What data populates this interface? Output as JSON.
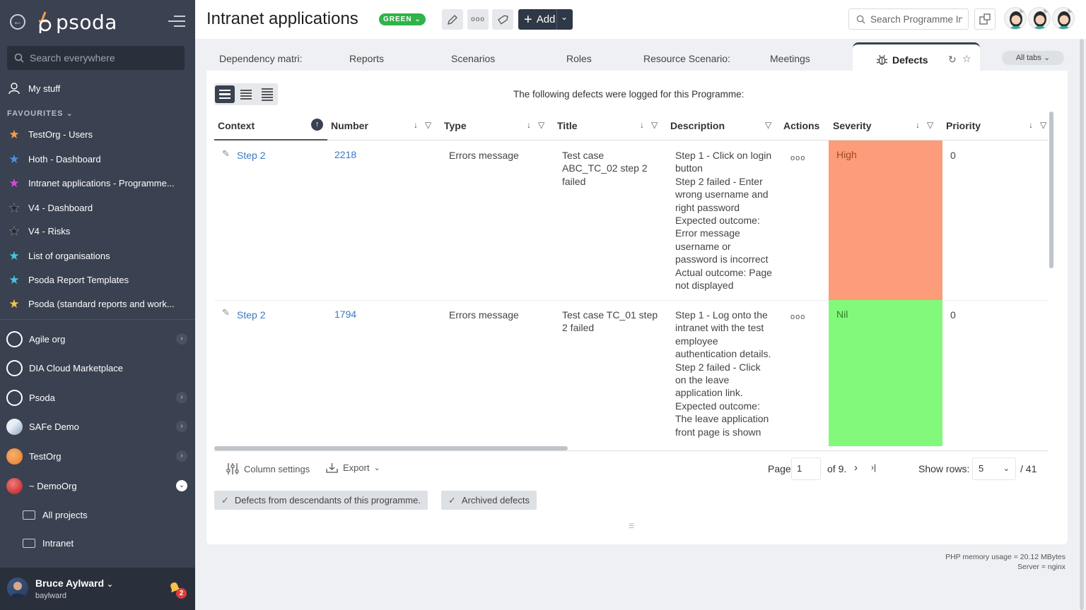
{
  "sidebar": {
    "search_placeholder": "Search everywhere",
    "my_stuff": "My stuff",
    "favourites_label": "FAVOURITES",
    "favourites": [
      {
        "label": "TestOrg - Users",
        "color": "#f5a24a"
      },
      {
        "label": "Hoth - Dashboard",
        "color": "#4a90e2"
      },
      {
        "label": "Intranet applications - Programme...",
        "color": "#d54ad5"
      },
      {
        "label": "V4 - Dashboard",
        "color": "#2a303b"
      },
      {
        "label": "V4 - Risks",
        "color": "#2a303b"
      },
      {
        "label": "List of organisations",
        "color": "#4ac2e2"
      },
      {
        "label": "Psoda Report Templates",
        "color": "#4ac2e2"
      },
      {
        "label": "Psoda (standard reports and work...",
        "color": "#f5c24a"
      }
    ],
    "orgs": [
      {
        "label": "Agile org",
        "chevron": true
      },
      {
        "label": "DIA Cloud Marketplace",
        "chevron": false
      },
      {
        "label": "Psoda",
        "chevron": true
      },
      {
        "label": "SAFe Demo",
        "chevron": true
      },
      {
        "label": "TestOrg",
        "chevron": true
      },
      {
        "label": "~ DemoOrg",
        "chevron": true
      }
    ],
    "sub_items": [
      "All projects",
      "Intranet"
    ],
    "user": {
      "name": "Bruce Aylward",
      "login": "baylward"
    },
    "notifications": "2"
  },
  "header": {
    "logo_text": "psoda",
    "title": "Intranet applications",
    "status": "GREEN",
    "add_label": "Add",
    "search_placeholder": "Search Programme Intranet applications"
  },
  "tabs": {
    "items": [
      "Dependency matri:",
      "Reports",
      "Scenarios",
      "Roles",
      "Resource Scenario:",
      "Meetings"
    ],
    "active": "Defects",
    "all_tabs": "All tabs"
  },
  "defects": {
    "intro": "The following defects were logged for this Programme:",
    "columns": [
      "Context",
      "Number",
      "Type",
      "Title",
      "Description",
      "Actions",
      "Severity",
      "Priority"
    ],
    "rows": [
      {
        "context": "Step 2",
        "number": "2218",
        "type": "Errors message",
        "title": "Test case ABC_TC_02 step 2 failed",
        "description": [
          "Step 1 - Click on login button",
          "Step 2 failed - Enter wrong username and right password",
          "Expected outcome: Error message username or password is incorrect",
          "Actual outcome: Page not displayed"
        ],
        "severity": "High",
        "severity_color": "#fc9c7a",
        "priority": "0"
      },
      {
        "context": "Step 2",
        "number": "1794",
        "type": "Errors message",
        "title": "Test case TC_01 step 2 failed",
        "description": [
          "Step 1 - Log onto the intranet with the test employee authentication details.",
          "Step 2 failed - Click on the leave application link.",
          "Expected outcome: The leave application front page is shown"
        ],
        "severity": "Nil",
        "severity_color": "#82f97a",
        "priority": "0"
      }
    ],
    "footer": {
      "column_settings": "Column settings",
      "export": "Export",
      "page_label": "Page",
      "page_value": "1",
      "of_pages": "of 9.",
      "show_rows_label": "Show rows:",
      "rows_value": "5",
      "total": "/ 41"
    },
    "filters": [
      "Defects from descendants of this programme.",
      "Archived defects"
    ]
  },
  "server_info": {
    "memory": "PHP memory usage = 20.12 MBytes",
    "server": "Server = nginx"
  }
}
